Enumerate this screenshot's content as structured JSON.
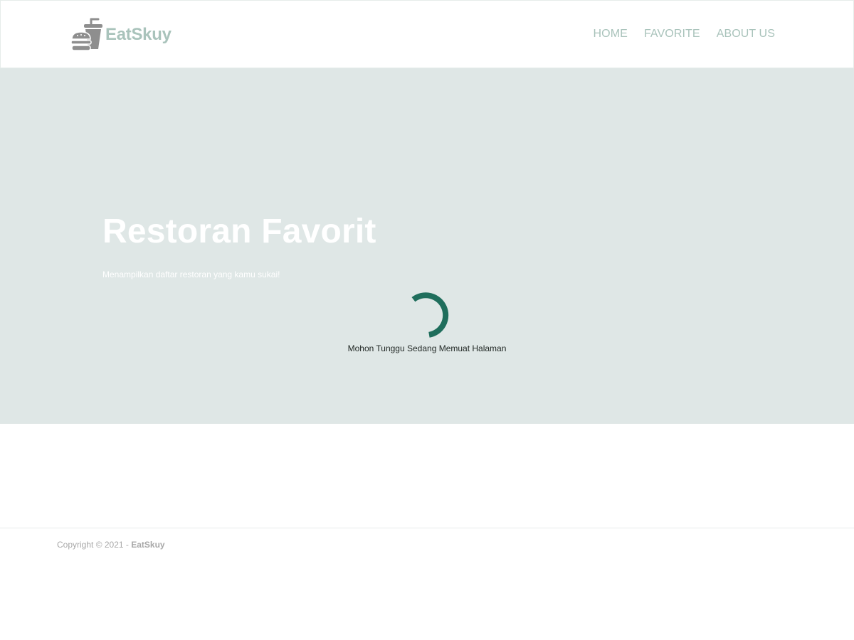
{
  "header": {
    "brand": {
      "name": "EatSkuy",
      "icon": "food-burger-drink-icon"
    },
    "nav": [
      {
        "label": "HOME"
      },
      {
        "label": "FAVORITE"
      },
      {
        "label": "ABOUT US"
      }
    ]
  },
  "hero": {
    "title": "Restoran Favorit",
    "subtitle": "Menampilkan daftar restoran yang kamu sukai!"
  },
  "loading": {
    "icon": "loading-spinner-icon",
    "text": "Mohon Tunggu Sedang Memuat Halaman"
  },
  "footer": {
    "copyright_prefix": "Copyright © 2021 - ",
    "brand": "EatSkuy"
  },
  "colors": {
    "brand_text": "#a9c3bb",
    "brand_icon": "#8e8e8e",
    "nav_link": "#a9c3bb",
    "hero_bg": "#dfe7e6",
    "spinner": "#1f6e5c"
  }
}
